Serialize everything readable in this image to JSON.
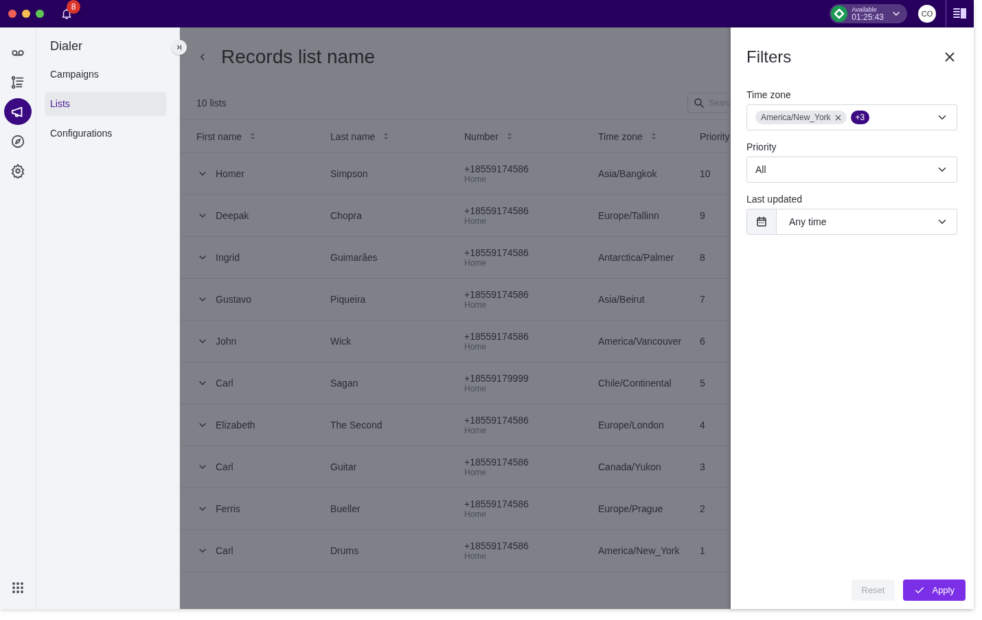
{
  "top_bar": {
    "notifications_badge": "8",
    "status": {
      "label": "Available",
      "timer": "01:25:43"
    },
    "avatar": "CO"
  },
  "rail": {
    "items": [
      {
        "kind": "voicemail",
        "selected": false
      },
      {
        "kind": "list",
        "selected": false
      },
      {
        "kind": "megaphone",
        "selected": true
      },
      {
        "kind": "compass",
        "selected": false
      },
      {
        "kind": "gear",
        "selected": false
      }
    ]
  },
  "nav": {
    "title": "Dialer",
    "items": [
      {
        "label": "Campaigns",
        "selected": false
      },
      {
        "label": "Lists",
        "selected": true
      },
      {
        "label": "Configurations",
        "selected": false
      }
    ]
  },
  "page": {
    "title": "Records list name",
    "count": "10 lists",
    "search": {
      "placeholder": "Searc"
    }
  },
  "table": {
    "columns": [
      "First name",
      "Last name",
      "Number",
      "Time zone",
      "Priority"
    ],
    "rows": [
      {
        "first_name": "Homer",
        "last_name": "Simpson",
        "number": "+18559174586",
        "number_type": "Home",
        "time_zone": "Asia/Bangkok",
        "priority": "10"
      },
      {
        "first_name": "Deepak",
        "last_name": "Chopra",
        "number": "+18559174586",
        "number_type": "Home",
        "time_zone": "Europe/Tallinn",
        "priority": "9"
      },
      {
        "first_name": "Ingrid",
        "last_name": "Guimarães",
        "number": "+18559174586",
        "number_type": "Home",
        "time_zone": "Antarctica/Palmer",
        "priority": "8"
      },
      {
        "first_name": "Gustavo",
        "last_name": "Piqueira",
        "number": "+18559174586",
        "number_type": "Home",
        "time_zone": "Asia/Beirut",
        "priority": "7"
      },
      {
        "first_name": "John",
        "last_name": "Wick",
        "number": "+18559174586",
        "number_type": "Home",
        "time_zone": "America/Vancouver",
        "priority": "6"
      },
      {
        "first_name": "Carl",
        "last_name": "Sagan",
        "number": "+18559179999",
        "number_type": "Home",
        "time_zone": "Chile/Continental",
        "priority": "5"
      },
      {
        "first_name": "Elizabeth",
        "last_name": "The Second",
        "number": "+18559174586",
        "number_type": "Home",
        "time_zone": "Europe/London",
        "priority": "4"
      },
      {
        "first_name": "Carl",
        "last_name": "Guitar",
        "number": "+18559174586",
        "number_type": "Home",
        "time_zone": "Canada/Yukon",
        "priority": "3"
      },
      {
        "first_name": "Ferris",
        "last_name": "Bueller",
        "number": "+18559174586",
        "number_type": "Home",
        "time_zone": "Europe/Prague",
        "priority": "2"
      },
      {
        "first_name": "Carl",
        "last_name": "Drums",
        "number": "+18559174586",
        "number_type": "Home",
        "time_zone": "America/New_York",
        "priority": "1"
      }
    ]
  },
  "filters": {
    "title": "Filters",
    "time_zone": {
      "label": "Time zone",
      "chips": [
        "America/New_York"
      ],
      "more": "+3"
    },
    "priority": {
      "label": "Priority",
      "value": "All"
    },
    "last_updated": {
      "label": "Last updated",
      "value": "Any time"
    },
    "buttons": [
      {
        "kind": "reset",
        "label": "Reset",
        "disabled": true
      },
      {
        "kind": "apply",
        "label": "Apply",
        "disabled": false
      }
    ]
  }
}
